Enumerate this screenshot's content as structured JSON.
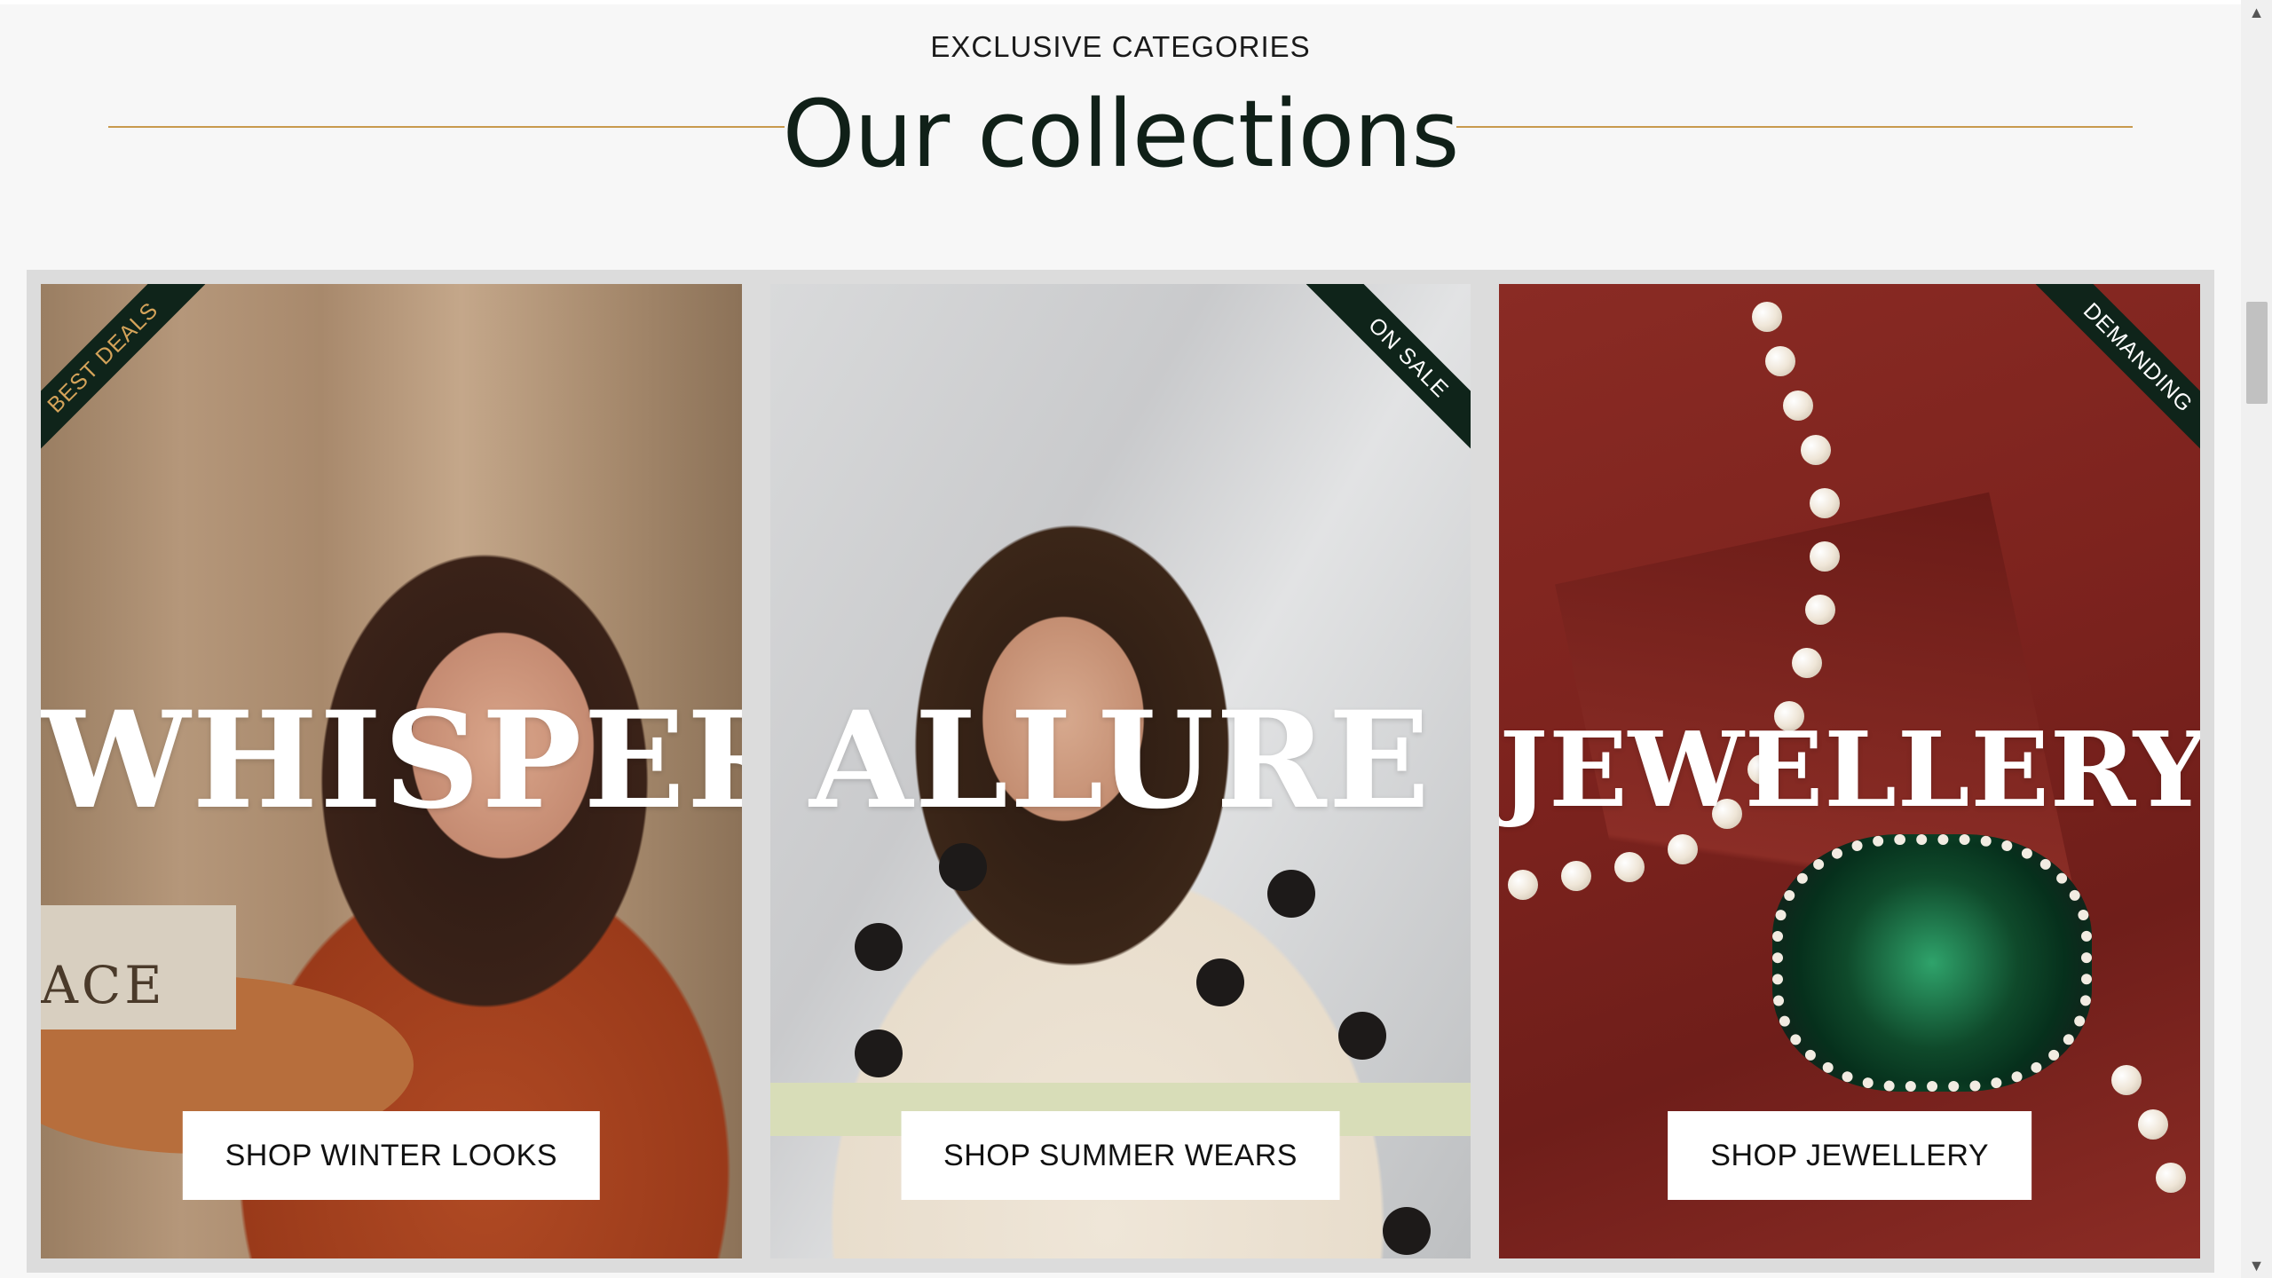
{
  "section": {
    "eyebrow": "EXCLUSIVE CATEGORIES",
    "heading": "Our collections"
  },
  "cards": [
    {
      "ribbon": "BEST DEALS",
      "title": "WHISPER",
      "button": "SHOP WINTER LOOKS"
    },
    {
      "ribbon": "ON SALE",
      "title": "ALLURE",
      "button": "SHOP SUMMER WEARS"
    },
    {
      "ribbon": "DEMANDING",
      "title": "JEWELLERY",
      "button": "SHOP JEWELLERY"
    }
  ],
  "decor": {
    "book_text": "ACE"
  },
  "colors": {
    "accent_rule": "#c89a4e",
    "heading": "#102018",
    "ribbon_bg": "#0f241a",
    "best_deals_text": "#d4a35a"
  }
}
